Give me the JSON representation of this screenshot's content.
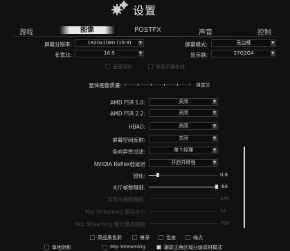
{
  "header": {
    "title": "设置",
    "icon": "gears-icon"
  },
  "tabs": [
    {
      "label": "游戏"
    },
    {
      "label": "图像",
      "active": true
    },
    {
      "label": "POSTFX"
    },
    {
      "label": "声音"
    },
    {
      "label": "控制"
    }
  ],
  "top_settings": {
    "resolution_label": "屏幕分辨率:",
    "resolution_value": "1920x1080 (16:9)",
    "aspect_label": "长宽比:",
    "aspect_value": "16:9",
    "screen_mode_label": "屏幕模式:",
    "screen_mode_value": "无边框",
    "display_label": "显示器:",
    "display_value": "27G2G4",
    "vsync_label": "垂直同步",
    "multimonitor_label": "多显示器支持"
  },
  "quality": {
    "label": "整体图像质量:",
    "value": "自定义"
  },
  "settings": [
    {
      "label": "AMD FSR 1.0:",
      "value": "关闭"
    },
    {
      "label": "AMD FSR 2.2:",
      "value": "关闭"
    },
    {
      "label": "HBAO:",
      "value": "关闭"
    },
    {
      "label": "屏幕空间反射:",
      "value": "关闭"
    },
    {
      "label": "各向异性过滤:",
      "value": "单个纹理"
    },
    {
      "label": "NVIDIA Reflex低延迟",
      "value": "开启并增强"
    }
  ],
  "sliders": {
    "sharpen_label": "锐化:",
    "sharpen_value": "0.6",
    "sharpen_level": 0.13,
    "lobby_fps_label": "大厅帧数限制:",
    "lobby_fps_value": "60",
    "ingame_fps_label": "游戏内帧数限制:",
    "ingame_fps_value": "144",
    "mip_pool_label": "Mip Streaming 缓存大小",
    "mip_pool_value": "32",
    "mip_budget_label": "Mip Streaming 缓存最高限制",
    "mip_budget_value": "768"
  },
  "options_row1": [
    {
      "label": "高品质色彩"
    },
    {
      "label": "景深"
    },
    {
      "label": "色差"
    },
    {
      "label": "噪点"
    }
  ],
  "options_row2": [
    {
      "label": "草地阴影"
    },
    {
      "label": "Mip Streaming"
    },
    {
      "label": "跟踪主角区域分级高材模式",
      "checked": true
    }
  ]
}
